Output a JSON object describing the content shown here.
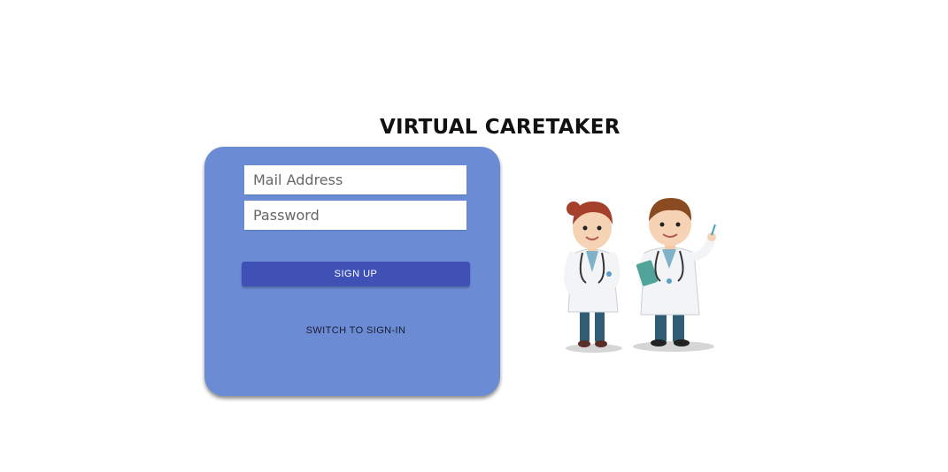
{
  "header": {
    "title": "VIRTUAL CARETAKER"
  },
  "form": {
    "mail_placeholder": "Mail Address",
    "password_placeholder": "Password",
    "signup_label": "SIGN UP",
    "switch_label": "SWITCH TO SIGN-IN"
  },
  "illustration": {
    "icon": "doctors-illustration-icon"
  },
  "colors": {
    "card_background": "#6b8cd5",
    "button_background": "#3f51b5",
    "page_background": "#ffffff"
  }
}
